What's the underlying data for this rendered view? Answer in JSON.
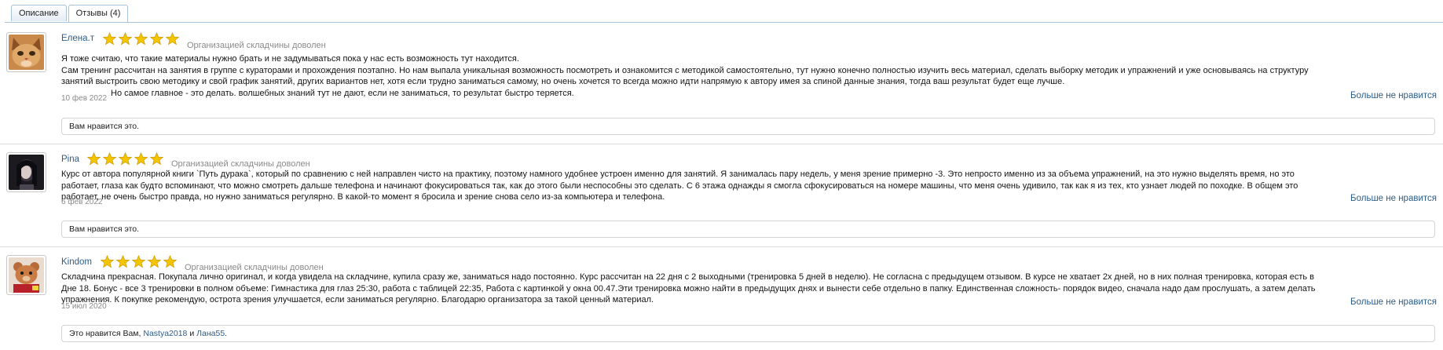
{
  "tabs": [
    {
      "label": "Описание",
      "active": false
    },
    {
      "label": "Отзывы (4)",
      "active": true
    }
  ],
  "colors": {
    "link": "#2b5d8a",
    "muted": "#8a8a8a",
    "star": "#f4c400",
    "tab_border": "#a7c3d9"
  },
  "reviews": [
    {
      "author": "Елена.т",
      "rating": 5,
      "rating_text": "Организацией складчины доволен",
      "text_lines": [
        "Я тоже считаю, что такие материалы нужно брать и не задумываться пока у нас есть возможность тут находится.",
        "Сам тренинг рассчитан на занятия в группе с кураторами и прохождения поэтапно. Но нам выпала уникальная возможность посмотреть и ознакомится с методикой самостоятельно, тут нужно конечно полностью изучить весь материал, сделать выборку методик и упражнений и уже основываясь на структуру",
        "занятий выстроить свою методику и свой график занятий, других вариантов нет, хотя если трудно заниматься самому, но очень хочется то всегда можно идти напрямую к автору имея за спиной данные знания, тогда ваш результат будет еще лучше.",
        "Но самое главное - это делать. волшебных знаний тут не дают, если не заниматься, то результат быстро теряется."
      ],
      "date": "10 фев 2022",
      "unlike_label": "Больше не нравится",
      "likes_text": "Вам нравится это.",
      "avatar": "cat-avatar"
    },
    {
      "author": "Pina",
      "rating": 5,
      "rating_text": "Организацией складчины доволен",
      "text_lines": [
        "Курс от автора популярной книги `Путь дурака`, который по сравнению с ней направлен чисто на практику, поэтому намного удобнее устроен именно для занятий. Я занималась пару недель, у меня зрение примерно -3. Это непросто именно из за объема упражнений, на это нужно выделять время, но это",
        "работает, глаза как будто вспоминают, что можно смотреть дальше телефона и начинают фокусироваться так, как до этого были неспособны это сделать. С 6 этажа однажды я смогла сфокусироваться на номере машины, что меня очень удивило, так как я из тех, кто узнает людей по походке. В общем это",
        "работает, не очень быстро правда, но нужно заниматься регулярно. В какой-то момент я бросила и зрение снова село из-за компьютера и телефона."
      ],
      "date": "6 фев 2022",
      "unlike_label": "Больше не нравится",
      "likes_text": "Вам нравится это.",
      "avatar": "dark-hair-avatar"
    },
    {
      "author": "Kindom",
      "rating": 5,
      "rating_text": "Организацией складчины доволен",
      "text_lines": [
        "Складчина прекрасная. Покупала лично оригинал, и когда увидела на складчине, купила сразу же, заниматься надо постоянно. Курс рассчитан на 22 дня с 2 выходными (тренировка 5 дней в неделю). Не согласна с предыдущем отзывом. В курсе не хватает 2х дней, но в них полная тренировка, которая есть в",
        "Дне 18. Бонус - все 3 тренировки в полном объеме: Гимнастика для глаз 25:30, работа с таблицей 22:35, Работа с картинкой у окна 00.47.Эти тренировка можно найти в предыдущих днях и вынести себе отдельно в папку. Единственная сложность- порядок видео, сначала надо дам прослушать, а затем делать",
        "упражнения. К покупке рекомендую, острота зрения улучшается, если заниматься регулярно. Благодарю организатора за такой ценный материал."
      ],
      "date": "15 июл 2020",
      "unlike_label": "Больше не нравится",
      "likes_prefix": "Это нравится Вам, ",
      "likes_user1": "Nastya2018",
      "likes_and": " и ",
      "likes_user2": "Лана55",
      "likes_suffix": ".",
      "avatar": "plush-toy-avatar"
    }
  ]
}
